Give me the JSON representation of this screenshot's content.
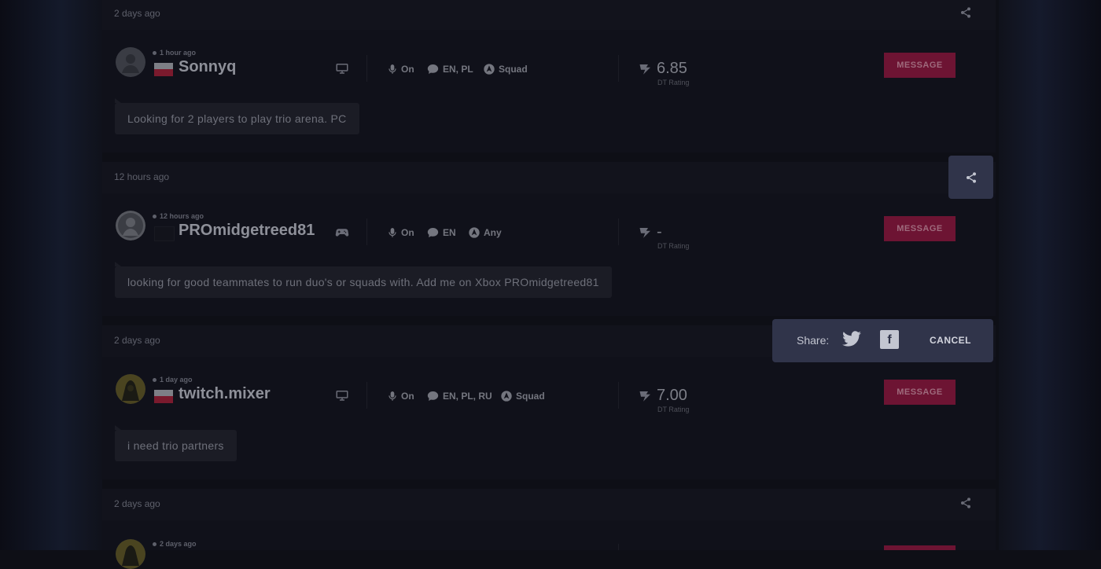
{
  "cards": [
    {
      "posted": "2 days ago",
      "online": "1 hour ago",
      "name": "Sonnyq",
      "platform": "pc",
      "mic": "On",
      "languages": "EN, PL",
      "mode": "Squad",
      "rating": "6.85",
      "rating_label": "DT Rating",
      "message_button": "MESSAGE",
      "post": "Looking for 2 players to play trio arena. PC"
    },
    {
      "posted": "12 hours ago",
      "online": "12 hours ago",
      "name": "PROmidgetreed81",
      "platform": "console",
      "mic": "On",
      "languages": "EN",
      "mode": "Any",
      "rating": "-",
      "rating_label": "DT Rating",
      "message_button": "MESSAGE",
      "post": "looking for good teammates to run duo's or squads with. Add me on Xbox PROmidgetreed81"
    },
    {
      "posted": "2 days ago",
      "online": "1 day ago",
      "name": "twitch.mixer",
      "platform": "pc",
      "mic": "On",
      "languages": "EN, PL, RU",
      "mode": "Squad",
      "rating": "7.00",
      "rating_label": "DT Rating",
      "message_button": "MESSAGE",
      "post": "i need trio partners"
    },
    {
      "posted": "2 days ago",
      "online": "2 days ago",
      "message_button": ""
    }
  ],
  "share_popup": {
    "label": "Share:",
    "cancel": "CANCEL"
  },
  "icons": {
    "share": "share-icon",
    "twitter": "twitter-icon",
    "facebook": "facebook-icon"
  }
}
